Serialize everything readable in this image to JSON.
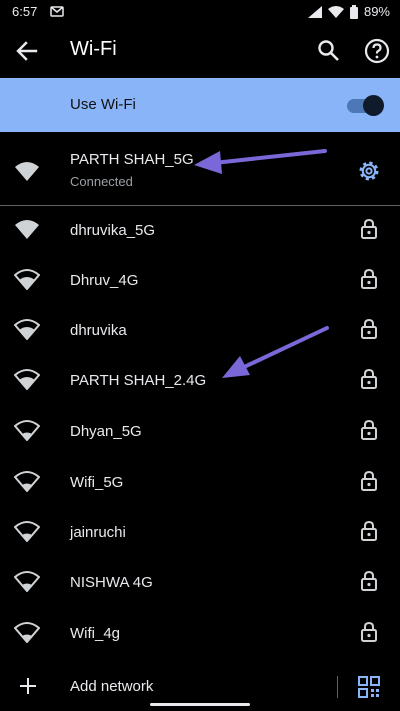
{
  "status_bar": {
    "time": "6:57",
    "battery": "89%"
  },
  "app_bar": {
    "title": "Wi-Fi"
  },
  "wifi_toggle": {
    "label": "Use Wi-Fi",
    "on": true
  },
  "connected_network": {
    "name": "PARTH SHAH_5G",
    "status": "Connected"
  },
  "networks": [
    {
      "name": "dhruvika_5G"
    },
    {
      "name": "Dhruv_4G"
    },
    {
      "name": "dhruvika"
    },
    {
      "name": "PARTH SHAH_2.4G"
    },
    {
      "name": "Dhyan_5G"
    },
    {
      "name": "Wifi_5G"
    },
    {
      "name": "jainruchi"
    },
    {
      "name": "NISHWA 4G"
    },
    {
      "name": "Wifi_4g"
    }
  ],
  "add_network": {
    "label": "Add network"
  },
  "colors": {
    "accent": "#8ab4f8",
    "annotation_arrow": "#7b68d8",
    "background": "#000000"
  },
  "icons": [
    "wifi-icon",
    "lock-icon",
    "gear-icon",
    "search-icon",
    "help-icon",
    "back-arrow-icon",
    "add-icon",
    "qr-code-icon"
  ]
}
